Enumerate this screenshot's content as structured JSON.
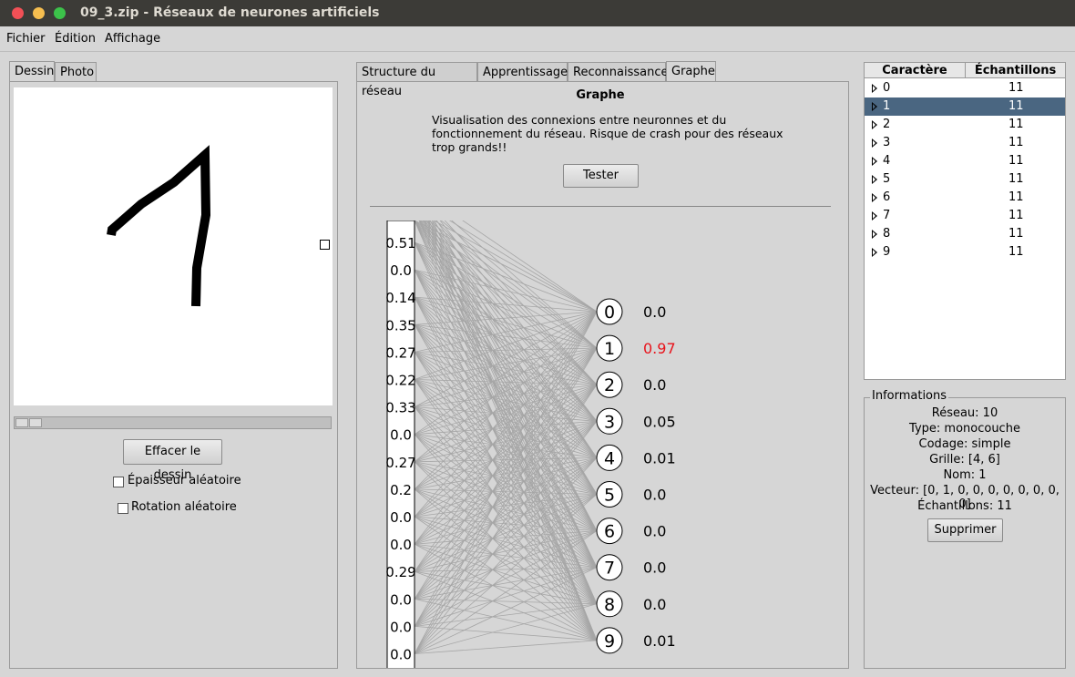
{
  "window": {
    "title": "09_3.zip - Réseaux de neurones artificiels"
  },
  "menu": [
    "Fichier",
    "Édition",
    "Affichage"
  ],
  "left": {
    "tabs": [
      "Dessin",
      "Photo"
    ],
    "clear_button": "Effacer le dessin",
    "checkbox_thickness": "Épaisseur aléatoire",
    "checkbox_rotation": "Rotation aléatoire"
  },
  "middle": {
    "tabs": [
      "Structure du réseau",
      "Apprentissage",
      "Reconnaissance",
      "Graphe"
    ],
    "title": "Graphe",
    "description": "Visualisation des connexions entre neuronnes et du fonctionnement du réseau. Risque de crash pour des réseaux trop grands!!",
    "test_button": "Tester",
    "inputs": [
      "0.51",
      "0.0",
      "0.14",
      "0.35",
      "0.27",
      "0.22",
      "0.33",
      "0.0",
      "0.27",
      "0.2",
      "0.0",
      "0.0",
      "0.29",
      "0.0",
      "0.0",
      "0.0"
    ],
    "outputs": [
      {
        "label": "0",
        "value": "0.0"
      },
      {
        "label": "1",
        "value": "0.97"
      },
      {
        "label": "2",
        "value": "0.0"
      },
      {
        "label": "3",
        "value": "0.05"
      },
      {
        "label": "4",
        "value": "0.01"
      },
      {
        "label": "5",
        "value": "0.0"
      },
      {
        "label": "6",
        "value": "0.0"
      },
      {
        "label": "7",
        "value": "0.0"
      },
      {
        "label": "8",
        "value": "0.0"
      },
      {
        "label": "9",
        "value": "0.01"
      }
    ],
    "highlight_color": "#e8131b"
  },
  "list": {
    "headers": [
      "Caractère",
      "Échantillons"
    ],
    "rows": [
      {
        "char": "0",
        "count": "11"
      },
      {
        "char": "1",
        "count": "11"
      },
      {
        "char": "2",
        "count": "11"
      },
      {
        "char": "3",
        "count": "11"
      },
      {
        "char": "4",
        "count": "11"
      },
      {
        "char": "5",
        "count": "11"
      },
      {
        "char": "6",
        "count": "11"
      },
      {
        "char": "7",
        "count": "11"
      },
      {
        "char": "8",
        "count": "11"
      },
      {
        "char": "9",
        "count": "11"
      }
    ],
    "selected": 1
  },
  "info": {
    "legend": "Informations",
    "lines": [
      "Réseau: 10",
      "Type: monocouche",
      "Codage: simple",
      "Grille: [4, 6]",
      "Nom: 1",
      "Vecteur: [0, 1, 0, 0, 0, 0, 0, 0, 0, 0]",
      "Échantillons: 11"
    ],
    "delete_button": "Supprimer"
  }
}
